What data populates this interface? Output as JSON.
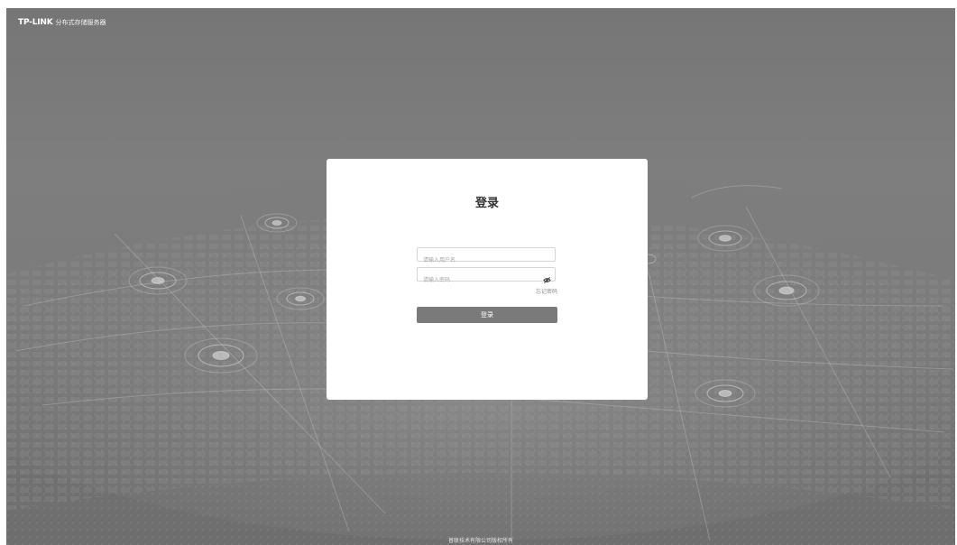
{
  "header": {
    "logo_text": "TP-LINK",
    "product_name": "分布式存储服务器"
  },
  "login": {
    "title": "登录",
    "username_placeholder": "请输入用户名",
    "password_placeholder": "请输入密码",
    "forgot_password": "忘记密码",
    "submit_label": "登录",
    "visibility_icon": "eye-off-icon"
  },
  "footer": {
    "copyright": "普联技术有限公司版权所有"
  },
  "colors": {
    "background": "#7a7a7a",
    "card": "#ffffff",
    "button": "#7a7a7a",
    "button_text": "#ffffff"
  }
}
